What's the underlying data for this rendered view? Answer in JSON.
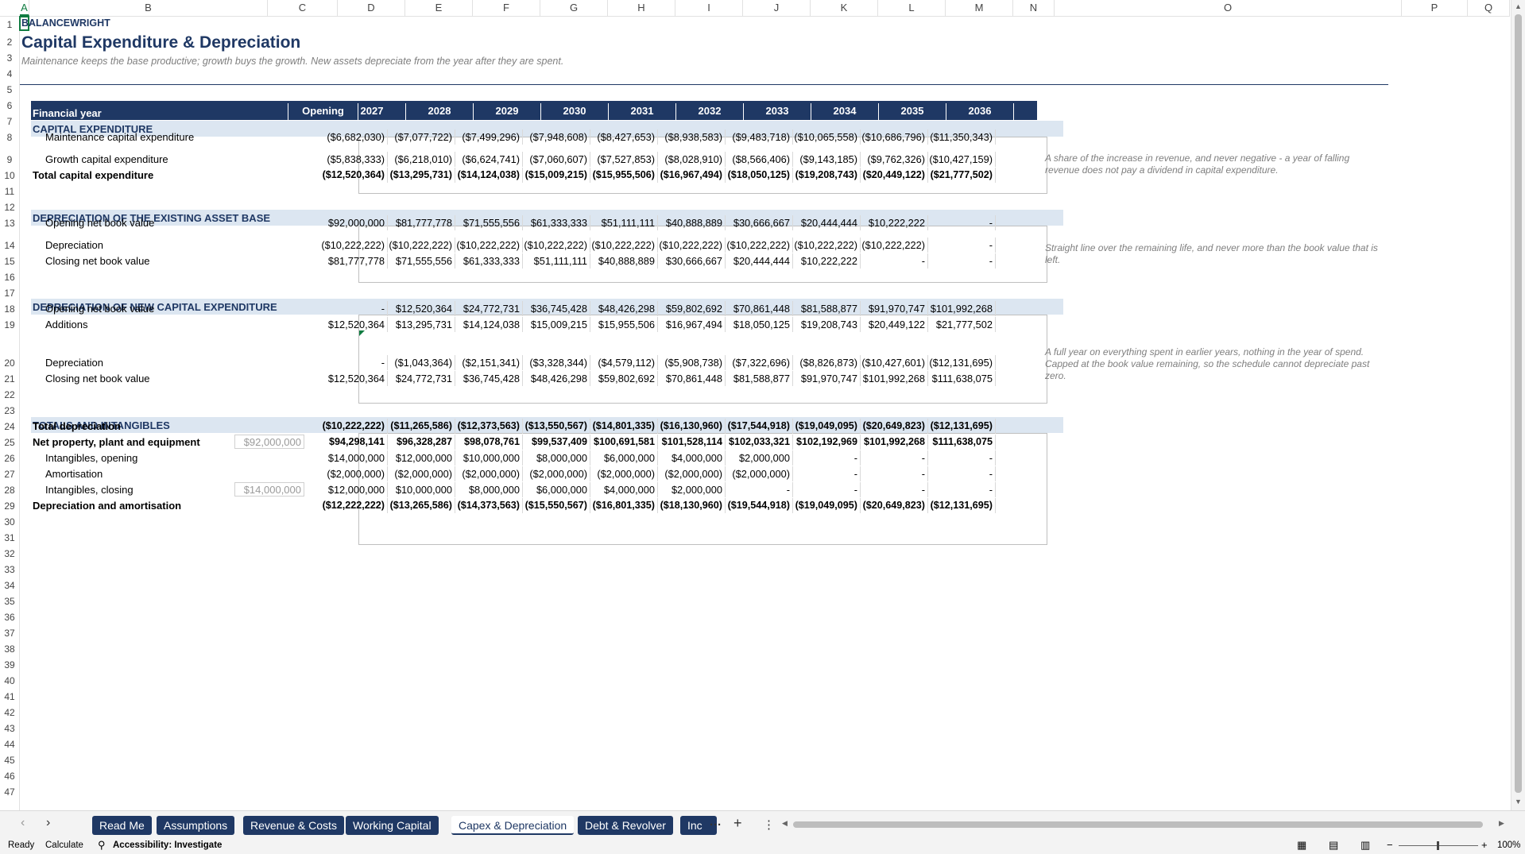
{
  "columns": [
    "A",
    "B",
    "C",
    "D",
    "E",
    "F",
    "G",
    "H",
    "I",
    "J",
    "K",
    "L",
    "M",
    "N",
    "O",
    "P",
    "Q"
  ],
  "rows": [
    "1",
    "2",
    "3",
    "4",
    "5",
    "6",
    "7",
    "8",
    "9",
    "10",
    "11",
    "12",
    "13",
    "14",
    "15",
    "16",
    "17",
    "18",
    "19",
    "20",
    "21",
    "22",
    "23",
    "24",
    "25",
    "26",
    "27",
    "28",
    "29",
    "30",
    "31",
    "32",
    "33",
    "34",
    "35",
    "36",
    "37",
    "38",
    "39",
    "40",
    "41",
    "42",
    "43",
    "44",
    "45",
    "46",
    "47"
  ],
  "sheet": {
    "brand": "BALANCEWRIGHT",
    "title": "Capital Expenditure & Depreciation",
    "subtitle": "Maintenance keeps the base productive; growth buys the growth. New assets depreciate from the year after they are spent.",
    "header": {
      "label": "Financial year",
      "opening": "Opening",
      "years": [
        "2027",
        "2028",
        "2029",
        "2030",
        "2031",
        "2032",
        "2033",
        "2034",
        "2035",
        "2036"
      ]
    },
    "sections": {
      "capex": "CAPITAL EXPENDITURE",
      "existing": "DEPRECIATION OF THE EXISTING ASSET BASE",
      "newcapex": "DEPRECIATION OF NEW CAPITAL EXPENDITURE",
      "totals": "TOTALS AND INTANGIBLES"
    },
    "lines": [
      {
        "row": 8,
        "label": "Maintenance capital expenditure",
        "indent": true,
        "bold": false,
        "values": [
          "($6,682,030)",
          "($7,077,722)",
          "($7,499,296)",
          "($7,948,608)",
          "($8,427,653)",
          "($8,938,583)",
          "($9,483,718)",
          "($10,065,558)",
          "($10,686,796)",
          "($11,350,343)"
        ]
      },
      {
        "row": 9,
        "label": "Growth capital expenditure",
        "indent": true,
        "bold": false,
        "values": [
          "($5,838,333)",
          "($6,218,010)",
          "($6,624,741)",
          "($7,060,607)",
          "($7,527,853)",
          "($8,028,910)",
          "($8,566,406)",
          "($9,143,185)",
          "($9,762,326)",
          "($10,427,159)"
        ]
      },
      {
        "row": 10,
        "label": "Total capital expenditure",
        "indent": false,
        "bold": true,
        "values": [
          "($12,520,364)",
          "($13,295,731)",
          "($14,124,038)",
          "($15,009,215)",
          "($15,955,506)",
          "($16,967,494)",
          "($18,050,125)",
          "($19,208,743)",
          "($20,449,122)",
          "($21,777,502)"
        ]
      },
      {
        "row": 13,
        "label": "Opening net book value",
        "indent": true,
        "bold": false,
        "values": [
          "$92,000,000",
          "$81,777,778",
          "$71,555,556",
          "$61,333,333",
          "$51,111,111",
          "$40,888,889",
          "$30,666,667",
          "$20,444,444",
          "$10,222,222",
          "-"
        ]
      },
      {
        "row": 14,
        "label": "Depreciation",
        "indent": true,
        "bold": false,
        "values": [
          "($10,222,222)",
          "($10,222,222)",
          "($10,222,222)",
          "($10,222,222)",
          "($10,222,222)",
          "($10,222,222)",
          "($10,222,222)",
          "($10,222,222)",
          "($10,222,222)",
          "-"
        ]
      },
      {
        "row": 15,
        "label": "Closing net book value",
        "indent": true,
        "bold": false,
        "values": [
          "$81,777,778",
          "$71,555,556",
          "$61,333,333",
          "$51,111,111",
          "$40,888,889",
          "$30,666,667",
          "$20,444,444",
          "$10,222,222",
          "-",
          "-"
        ]
      },
      {
        "row": 18,
        "label": "Opening net book value",
        "indent": true,
        "bold": false,
        "values": [
          "-",
          "$12,520,364",
          "$24,772,731",
          "$36,745,428",
          "$48,426,298",
          "$59,802,692",
          "$70,861,448",
          "$81,588,877",
          "$91,970,747",
          "$101,992,268"
        ]
      },
      {
        "row": 19,
        "label": "Additions",
        "indent": true,
        "bold": false,
        "values": [
          "$12,520,364",
          "$13,295,731",
          "$14,124,038",
          "$15,009,215",
          "$15,955,506",
          "$16,967,494",
          "$18,050,125",
          "$19,208,743",
          "$20,449,122",
          "$21,777,502"
        ]
      },
      {
        "row": 20,
        "label": "Depreciation",
        "indent": true,
        "bold": false,
        "values": [
          "-",
          "($1,043,364)",
          "($2,151,341)",
          "($3,328,344)",
          "($4,579,112)",
          "($5,908,738)",
          "($7,322,696)",
          "($8,826,873)",
          "($10,427,601)",
          "($12,131,695)"
        ]
      },
      {
        "row": 21,
        "label": "Closing net book value",
        "indent": true,
        "bold": false,
        "values": [
          "$12,520,364",
          "$24,772,731",
          "$36,745,428",
          "$48,426,298",
          "$59,802,692",
          "$70,861,448",
          "$81,588,877",
          "$91,970,747",
          "$101,992,268",
          "$111,638,075"
        ]
      },
      {
        "row": 24,
        "label": "Total depreciation",
        "indent": false,
        "bold": true,
        "values": [
          "($10,222,222)",
          "($11,265,586)",
          "($12,373,563)",
          "($13,550,567)",
          "($14,801,335)",
          "($16,130,960)",
          "($17,544,918)",
          "($19,049,095)",
          "($20,649,823)",
          "($12,131,695)"
        ]
      },
      {
        "row": 25,
        "label": "Net property, plant and equipment",
        "indent": false,
        "bold": true,
        "opening": "$92,000,000",
        "values": [
          "$94,298,141",
          "$96,328,287",
          "$98,078,761",
          "$99,537,409",
          "$100,691,581",
          "$101,528,114",
          "$102,033,321",
          "$102,192,969",
          "$101,992,268",
          "$111,638,075"
        ]
      },
      {
        "row": 26,
        "label": "Intangibles, opening",
        "indent": true,
        "bold": false,
        "values": [
          "$14,000,000",
          "$12,000,000",
          "$10,000,000",
          "$8,000,000",
          "$6,000,000",
          "$4,000,000",
          "$2,000,000",
          "-",
          "-",
          "-"
        ]
      },
      {
        "row": 27,
        "label": "Amortisation",
        "indent": true,
        "bold": false,
        "values": [
          "($2,000,000)",
          "($2,000,000)",
          "($2,000,000)",
          "($2,000,000)",
          "($2,000,000)",
          "($2,000,000)",
          "($2,000,000)",
          "-",
          "-",
          "-"
        ]
      },
      {
        "row": 28,
        "label": "Intangibles, closing",
        "indent": true,
        "bold": false,
        "opening": "$14,000,000",
        "values": [
          "$12,000,000",
          "$10,000,000",
          "$8,000,000",
          "$6,000,000",
          "$4,000,000",
          "$2,000,000",
          "-",
          "-",
          "-",
          "-"
        ]
      },
      {
        "row": 29,
        "label": "Depreciation and amortisation",
        "indent": false,
        "bold": true,
        "values": [
          "($12,222,222)",
          "($13,265,586)",
          "($14,373,563)",
          "($15,550,567)",
          "($16,801,335)",
          "($18,130,960)",
          "($19,544,918)",
          "($19,049,095)",
          "($20,649,823)",
          "($12,131,695)"
        ]
      }
    ],
    "notes": {
      "growth": "A share of the increase in revenue, and never negative - a year of falling revenue does not pay a dividend in capital expenditure.",
      "existing": "Straight line over the remaining life, and never more than the book value that is left.",
      "newcapex": "A full year on everything spent in earlier years, nothing in the year of spend. Capped at the book value remaining, so the schedule cannot depreciate past zero."
    }
  },
  "tabs": [
    "Read Me",
    "Assumptions",
    "Revenue & Costs",
    "Working Capital",
    "Capex & Depreciation",
    "Debt & Revolver",
    "Inc"
  ],
  "active_tab": "Capex & Depreciation",
  "tab_more": "···",
  "tab_add": "+",
  "tab_menu": "⋮",
  "status": {
    "ready": "Ready",
    "calculate": "Calculate",
    "accessibility": "Accessibility: Investigate",
    "zoom": "100%"
  }
}
